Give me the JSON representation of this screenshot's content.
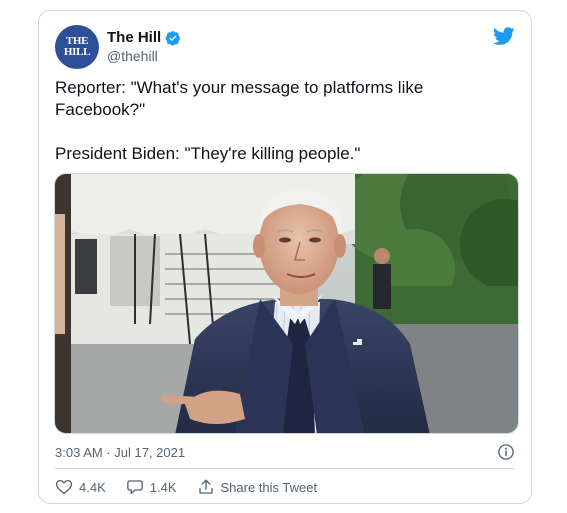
{
  "tweet": {
    "author": {
      "display_name": "The Hill",
      "handle": "@thehill",
      "avatar_line1": "THE",
      "avatar_line2": "HILL",
      "verified": true
    },
    "text": {
      "paragraph1": "Reporter: \"What's your message to platforms like Facebook?\"",
      "paragraph2": "President Biden: \"They're killing people.\""
    },
    "timestamp": "3:03 AM · Jul 17, 2021",
    "actions": {
      "like_count": "4.4K",
      "reply_count": "1.4K",
      "share_label": "Share this Tweet"
    }
  },
  "icons": {
    "brand": "twitter-bird-icon",
    "verified": "verified-badge-icon",
    "info": "info-icon",
    "like": "heart-icon",
    "reply": "reply-bubble-icon",
    "share": "share-icon"
  },
  "colors": {
    "twitter_blue": "#1d9bf0",
    "avatar_bg": "#2c4f97",
    "secondary_text": "#536471",
    "border": "#cfd9de"
  }
}
